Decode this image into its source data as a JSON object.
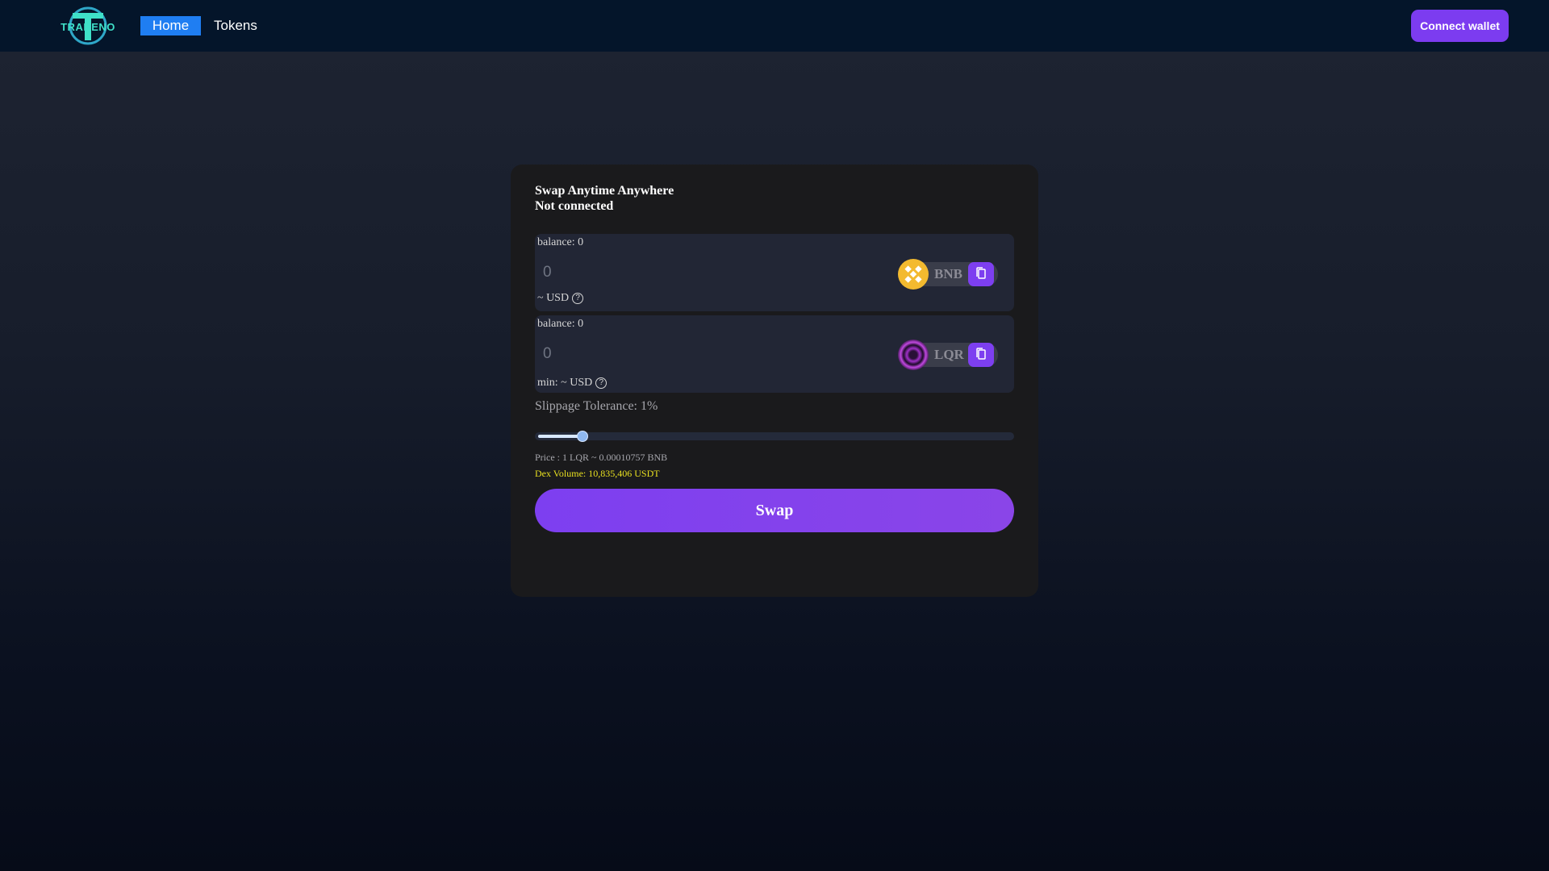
{
  "header": {
    "logo_text": "TRADENO",
    "nav": [
      {
        "label": "Home",
        "active": true
      },
      {
        "label": "Tokens",
        "active": false
      }
    ],
    "connect_label": "Connect wallet"
  },
  "swap": {
    "title": "Swap Anytime Anywhere",
    "status": "Not connected",
    "from": {
      "balance_label": "balance: 0",
      "amount_placeholder": "0",
      "usd_label": "~ USD",
      "token_symbol": "BNB",
      "token_icon": "bnb-icon"
    },
    "to": {
      "balance_label": "balance: 0",
      "amount_placeholder": "0",
      "usd_label": "min: ~ USD",
      "token_symbol": "LQR",
      "token_icon": "lqr-icon"
    },
    "slippage_label": "Slippage Tolerance: 1%",
    "slippage_fraction": 0.1,
    "price_label": "Price : 1 LQR ~ 0.00010757 BNB",
    "volume_label": "Dex Volume: 10,835,406 USDT",
    "swap_label": "Swap"
  },
  "colors": {
    "accent": "#7c3cf0",
    "nav_active": "#1f7ef2",
    "volume_text": "#e8e020",
    "bnb": "#f3ba2f"
  }
}
